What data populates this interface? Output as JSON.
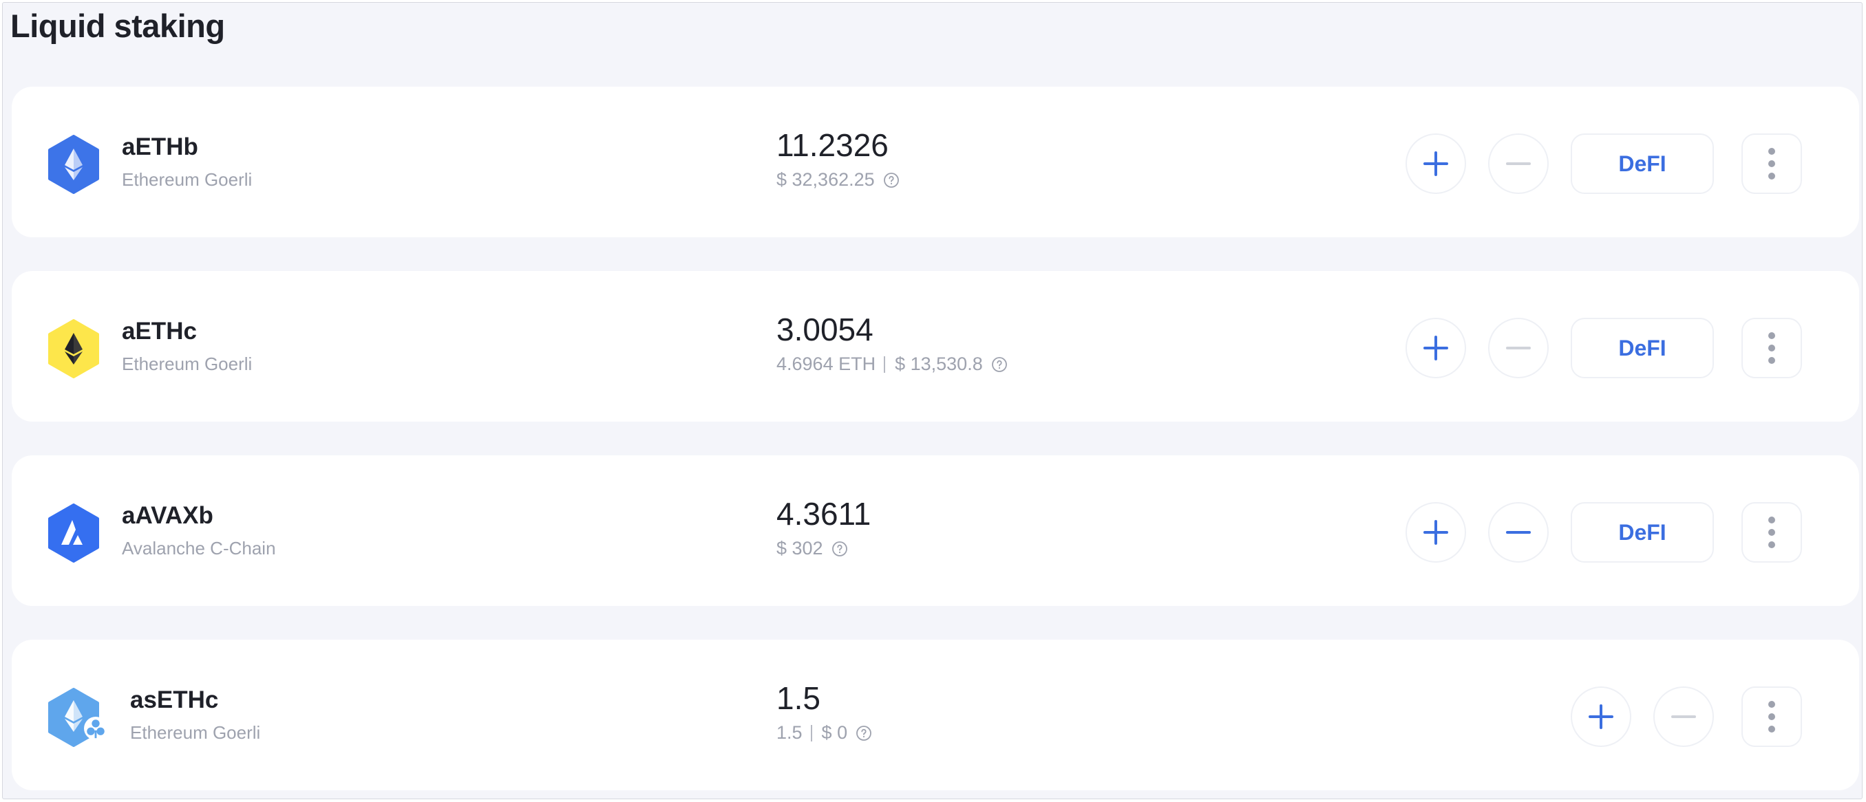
{
  "section": {
    "title": "Liquid staking"
  },
  "colors": {
    "accent": "#3b6ee0",
    "eth_blue": "#3d74e8",
    "eth_yellow": "#fde64b",
    "avax_blue": "#356ff0",
    "eth_light": "#5fa6ec",
    "muted": "#9ea2ae",
    "disabled": "#d0d3da"
  },
  "assets": [
    {
      "name": "aETHb",
      "network": "Ethereum Goerli",
      "amount": "11.2326",
      "secondary": "",
      "usd": "$ 32,362.25",
      "icon": "ethereum-blue-hexagon-icon",
      "add_enabled": true,
      "remove_enabled": false,
      "defi_label": "DeFI"
    },
    {
      "name": "aETHc",
      "network": "Ethereum Goerli",
      "amount": "3.0054",
      "secondary": "4.6964 ETH",
      "usd": "$ 13,530.8",
      "icon": "ethereum-yellow-hexagon-icon",
      "add_enabled": true,
      "remove_enabled": false,
      "defi_label": "DeFI"
    },
    {
      "name": "aAVAXb",
      "network": "Avalanche C-Chain",
      "amount": "4.3611",
      "secondary": "",
      "usd": "$ 302",
      "icon": "avalanche-hexagon-icon",
      "add_enabled": true,
      "remove_enabled": true,
      "defi_label": "DeFI"
    },
    {
      "name": "asETHc",
      "network": "Ethereum Goerli",
      "amount": "1.5",
      "secondary": "1.5",
      "usd": "$ 0",
      "icon": "ethereum-light-hexagon-icon",
      "add_enabled": true,
      "remove_enabled": false
    }
  ]
}
